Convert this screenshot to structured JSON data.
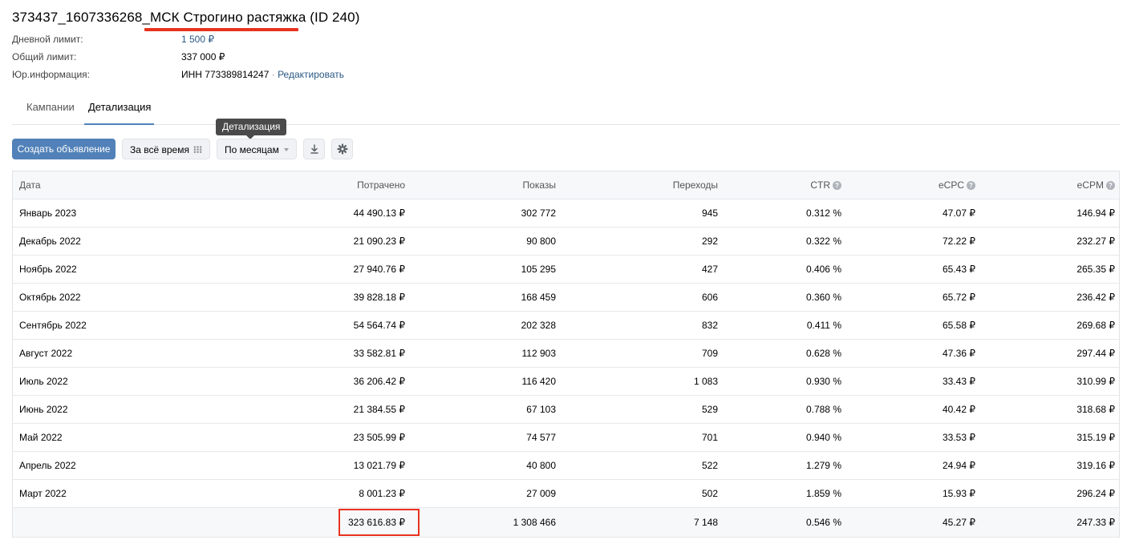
{
  "campaign": {
    "title": "373437_1607336268_МСК Строгино растяжка (ID 240)"
  },
  "info": {
    "daily_limit_label": "Дневной лимит:",
    "daily_limit_value": "1 500 ₽",
    "total_limit_label": "Общий лимит:",
    "total_limit_value": "337 000 ₽",
    "legal_label": "Юр.информация:",
    "legal_value": "ИНН 773389814247",
    "separator": "·",
    "edit_label": "Редактировать"
  },
  "tabs": [
    {
      "label": "Кампании",
      "active": false
    },
    {
      "label": "Детализация",
      "active": true
    }
  ],
  "tooltip": "Детализация",
  "toolbar": {
    "create_label": "Создать объявление",
    "period_label": "За всё время",
    "grouping_label": "По месяцам",
    "download_icon": "download-icon",
    "settings_icon": "gear-icon"
  },
  "table": {
    "headers": {
      "date": "Дата",
      "spent": "Потрачено",
      "impressions": "Показы",
      "clicks": "Переходы",
      "ctr": "CTR",
      "ecpc": "eCPC",
      "ecpm": "eCPM",
      "help_glyph": "?"
    },
    "rows": [
      {
        "date": "Январь 2023",
        "spent": "44 490.13 ₽",
        "impressions": "302 772",
        "clicks": "945",
        "ctr": "0.312 %",
        "ecpc": "47.07 ₽",
        "ecpm": "146.94 ₽"
      },
      {
        "date": "Декабрь 2022",
        "spent": "21 090.23 ₽",
        "impressions": "90 800",
        "clicks": "292",
        "ctr": "0.322 %",
        "ecpc": "72.22 ₽",
        "ecpm": "232.27 ₽"
      },
      {
        "date": "Ноябрь 2022",
        "spent": "27 940.76 ₽",
        "impressions": "105 295",
        "clicks": "427",
        "ctr": "0.406 %",
        "ecpc": "65.43 ₽",
        "ecpm": "265.35 ₽"
      },
      {
        "date": "Октябрь 2022",
        "spent": "39 828.18 ₽",
        "impressions": "168 459",
        "clicks": "606",
        "ctr": "0.360 %",
        "ecpc": "65.72 ₽",
        "ecpm": "236.42 ₽"
      },
      {
        "date": "Сентябрь 2022",
        "spent": "54 564.74 ₽",
        "impressions": "202 328",
        "clicks": "832",
        "ctr": "0.411 %",
        "ecpc": "65.58 ₽",
        "ecpm": "269.68 ₽"
      },
      {
        "date": "Август 2022",
        "spent": "33 582.81 ₽",
        "impressions": "112 903",
        "clicks": "709",
        "ctr": "0.628 %",
        "ecpc": "47.36 ₽",
        "ecpm": "297.44 ₽"
      },
      {
        "date": "Июль 2022",
        "spent": "36 206.42 ₽",
        "impressions": "116 420",
        "clicks": "1 083",
        "ctr": "0.930 %",
        "ecpc": "33.43 ₽",
        "ecpm": "310.99 ₽"
      },
      {
        "date": "Июнь 2022",
        "spent": "21 384.55 ₽",
        "impressions": "67 103",
        "clicks": "529",
        "ctr": "0.788 %",
        "ecpc": "40.42 ₽",
        "ecpm": "318.68 ₽"
      },
      {
        "date": "Май 2022",
        "spent": "23 505.99 ₽",
        "impressions": "74 577",
        "clicks": "701",
        "ctr": "0.940 %",
        "ecpc": "33.53 ₽",
        "ecpm": "315.19 ₽"
      },
      {
        "date": "Апрель 2022",
        "spent": "13 021.79 ₽",
        "impressions": "40 800",
        "clicks": "522",
        "ctr": "1.279 %",
        "ecpc": "24.94 ₽",
        "ecpm": "319.16 ₽"
      },
      {
        "date": "Март 2022",
        "spent": "8 001.23 ₽",
        "impressions": "27 009",
        "clicks": "502",
        "ctr": "1.859 %",
        "ecpc": "15.93 ₽",
        "ecpm": "296.24 ₽"
      }
    ],
    "total": {
      "date": "",
      "spent": "323 616.83 ₽",
      "impressions": "1 308 466",
      "clicks": "7 148",
      "ctr": "0.546 %",
      "ecpc": "45.27 ₽",
      "ecpm": "247.33 ₽"
    }
  },
  "colors": {
    "accent": "#5181b8",
    "link": "#2a5885",
    "highlight": "#e8321e"
  }
}
